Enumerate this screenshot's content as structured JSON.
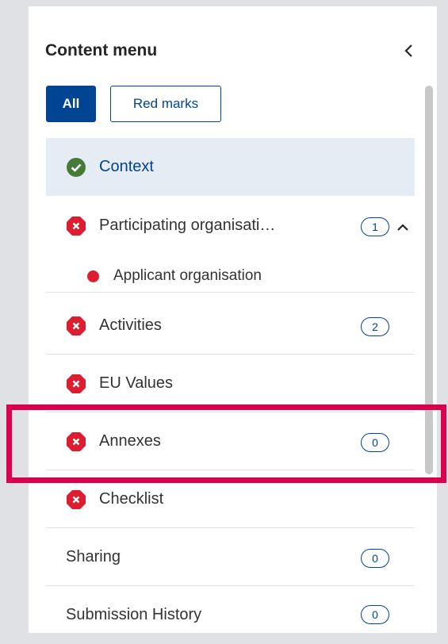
{
  "header": {
    "title": "Content menu"
  },
  "filters": {
    "all_label": "All",
    "red_marks_label": "Red marks"
  },
  "menu": {
    "context": {
      "label": "Context",
      "status": "complete"
    },
    "participating": {
      "label": "Participating organisati…",
      "badge": "1",
      "status": "error"
    },
    "applicant": {
      "label": "Applicant organisation"
    },
    "activities": {
      "label": "Activities",
      "badge": "2",
      "status": "error"
    },
    "eu_values": {
      "label": "EU Values",
      "status": "error"
    },
    "annexes": {
      "label": "Annexes",
      "badge": "0",
      "status": "error"
    },
    "checklist": {
      "label": "Checklist",
      "status": "error"
    },
    "sharing": {
      "label": "Sharing",
      "badge": "0"
    },
    "submission_history": {
      "label": "Submission History",
      "badge": "0"
    }
  },
  "colors": {
    "primary": "#004494",
    "error": "#dc1e30",
    "success": "#467a39",
    "highlight": "#d9004e"
  },
  "icons": {
    "collapse": "chevron-left-icon",
    "complete": "check-circle-icon",
    "error": "error-octagon-icon",
    "expand": "chevron-up-icon"
  }
}
